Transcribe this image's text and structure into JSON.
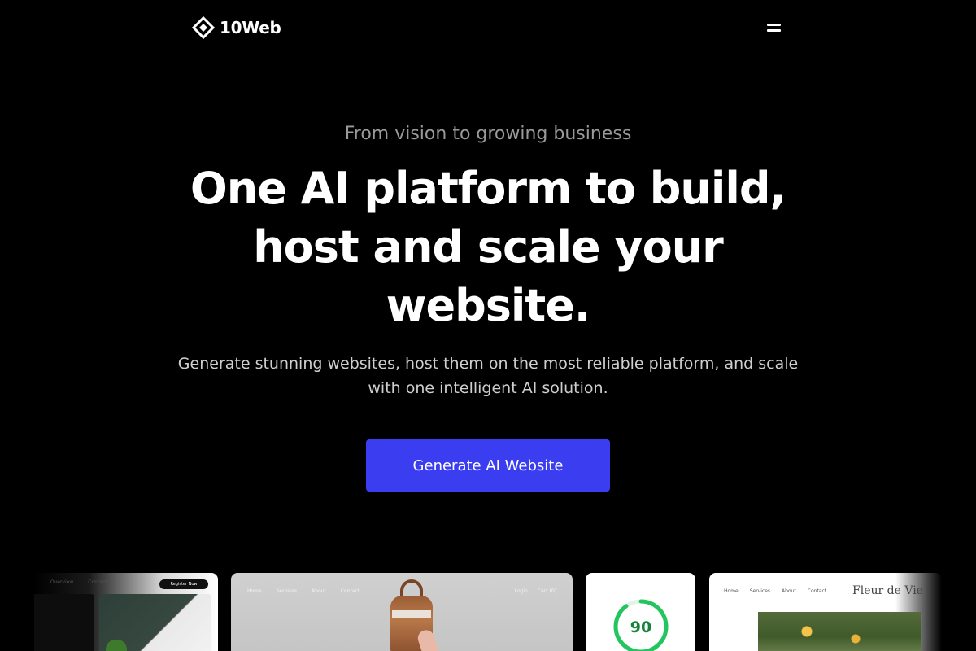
{
  "nav": {
    "logo_text": "10Web",
    "logo_icon": "diamond-logo-icon",
    "menu_icon": "hamburger-menu-icon"
  },
  "hero": {
    "eyebrow": "From vision to growing business",
    "headline": "One AI platform to build, host and scale your website.",
    "subtitle": "Generate stunning websites, host them on the most reliable platform, and scale with one intelligent AI solution.",
    "cta_label": "Generate AI Website",
    "cta_color": "#3b3df0"
  },
  "previews": {
    "card1": {
      "nav_items": [
        "Overview",
        "Contact"
      ],
      "button_label": "Register Now"
    },
    "card2": {
      "nav_items": [
        "Home",
        "Services",
        "About",
        "Contact"
      ],
      "right_items": [
        "Login",
        "Cart (0)"
      ]
    },
    "card3": {
      "score": "90",
      "score_fraction": 0.9,
      "score_color": "#17823a",
      "ring_color": "#22c55e"
    },
    "card4": {
      "nav_items": [
        "Home",
        "Services",
        "About",
        "Contact"
      ],
      "brand": "Fleur de Vie"
    }
  }
}
